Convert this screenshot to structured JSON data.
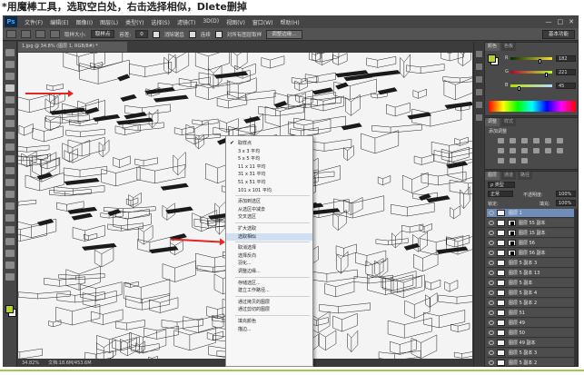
{
  "caption": "*用魔棒工具，选取空白处，右击选择相似，Dlete删掉",
  "app": {
    "logo": "Ps",
    "menu": [
      "文件(F)",
      "编辑(E)",
      "图像(I)",
      "图层(L)",
      "类型(Y)",
      "选择(S)",
      "滤镜(T)",
      "3D(D)",
      "视图(V)",
      "窗口(W)",
      "帮助(H)"
    ],
    "window_buttons": [
      "—",
      "□",
      "✕"
    ]
  },
  "options": {
    "sample_label": "取样大小:",
    "sample_value": "取样点",
    "tolerance_label": "容差:",
    "tolerance_value": "0",
    "antialias": "消除锯齿",
    "contiguous": "连续",
    "all_layers": "对所有图层取样",
    "refine": "调整边缘...",
    "workspace": "基本功能"
  },
  "document": {
    "tab": "1.jpg @ 34.8% (图层 1, RGB/8#) *",
    "zoom": "34.82%",
    "doc_info": "文档:18.6M/453.6M"
  },
  "context_menu": {
    "items": [
      {
        "label": "取样点",
        "checked": true
      },
      {
        "label": "3 x 3 平均"
      },
      {
        "label": "5 x 5 平均"
      },
      {
        "label": "11 x 11 平均"
      },
      {
        "label": "31 x 31 平均"
      },
      {
        "label": "51 x 51 平均"
      },
      {
        "label": "101 x 101 平均"
      },
      {
        "sep": true
      },
      {
        "label": "添加到选区"
      },
      {
        "label": "从选区中减去"
      },
      {
        "label": "交叉选区"
      },
      {
        "sep": true
      },
      {
        "label": "扩大选取"
      },
      {
        "label": "选取相似",
        "highlight": true
      },
      {
        "sep": true
      },
      {
        "label": "取消选择"
      },
      {
        "label": "选择反向"
      },
      {
        "label": "羽化..."
      },
      {
        "label": "调整边缘..."
      },
      {
        "sep": true
      },
      {
        "label": "存储选区..."
      },
      {
        "label": "建立工作路径..."
      },
      {
        "sep": true
      },
      {
        "label": "通过拷贝的图层"
      },
      {
        "label": "通过剪切的图层"
      },
      {
        "sep": true
      },
      {
        "label": "填充颜色"
      },
      {
        "label": "描边..."
      }
    ]
  },
  "color_panel": {
    "tabs": [
      "颜色",
      "色板"
    ],
    "channels": [
      {
        "letter": "R",
        "value": "182"
      },
      {
        "letter": "G",
        "value": "221"
      },
      {
        "letter": "B",
        "value": "45"
      }
    ]
  },
  "adjust_panel": {
    "tabs": [
      "调整",
      "样式"
    ],
    "label": "添加调整"
  },
  "layers_panel": {
    "tabs": [
      "图层",
      "通道",
      "路径"
    ],
    "kind": "ρ 类型",
    "blend": "正常",
    "opacity_label": "不透明度:",
    "opacity": "100%",
    "lock_label": "锁定:",
    "fill_label": "填充:",
    "fill": "100%",
    "layers": [
      {
        "name": "图层 1",
        "selected": true,
        "mask": false
      },
      {
        "name": "图层 55 副本",
        "mask": true
      },
      {
        "name": "图层 15 副本",
        "mask": true
      },
      {
        "name": "图层 56",
        "mask": true
      },
      {
        "name": "图层 56 副本",
        "mask": true
      },
      {
        "name": "图层 5 副本 3",
        "mask": false
      },
      {
        "name": "图层 5 副本 13",
        "mask": false
      },
      {
        "name": "图层 5 副本",
        "mask": false
      },
      {
        "name": "图层 5 副本 4",
        "mask": false
      },
      {
        "name": "图层 5 副本 2",
        "mask": false
      },
      {
        "name": "图层 51",
        "mask": false
      },
      {
        "name": "图层 49",
        "mask": false
      },
      {
        "name": "图层 50",
        "mask": false
      },
      {
        "name": "图层 49 副本",
        "mask": false
      },
      {
        "name": "图层 5 副本 3",
        "mask": false
      },
      {
        "name": "图层 5 副本 2",
        "mask": false
      }
    ]
  },
  "colors": {
    "foreground": "#b6d12f",
    "arrow": "#e52424"
  }
}
